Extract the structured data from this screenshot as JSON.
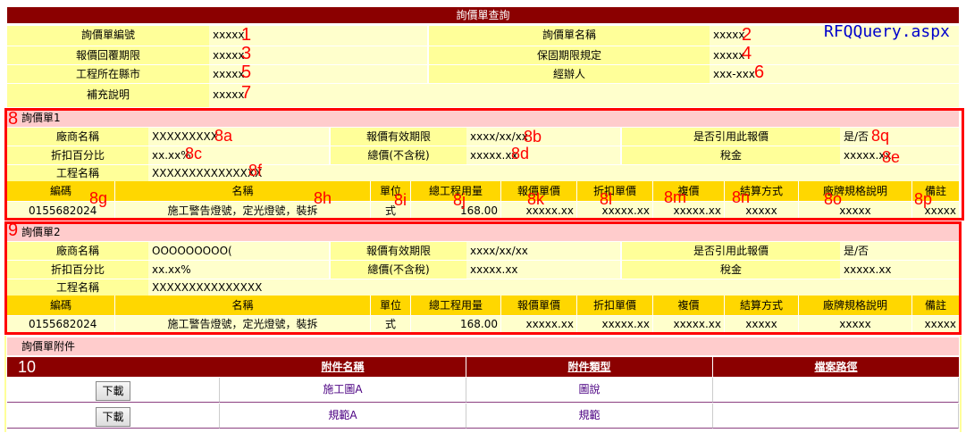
{
  "page_title": "詢價單查詢",
  "aspx": "RFQQuery.aspx",
  "header": {
    "rfq_no_label": "詢價單編號",
    "rfq_no_value": "xxxxx",
    "rfq_name_label": "詢價單名稱",
    "rfq_name_value": "xxxxx",
    "reply_deadline_label": "報價回覆期限",
    "reply_deadline_value": "xxxxx",
    "warranty_label": "保固期限規定",
    "warranty_value": "xxxxx",
    "location_label": "工程所在縣市",
    "location_value": "xxxxx",
    "handler_label": "經辦人",
    "handler_value": "xxx-xxx",
    "note_label": "補充說明",
    "note_value": "xxxxx"
  },
  "quotes": [
    {
      "title": "詢價單1",
      "vendor_label": "廠商名稱",
      "vendor_value": "XXXXXXXXX",
      "valid_label": "報價有效期限",
      "valid_value": "xxxx/xx/xx",
      "cite_label": "是否引用此報價",
      "cite_value": "是/否",
      "discount_label": "折扣百分比",
      "discount_value": "xx.xx%",
      "total_label": "總價(不含稅)",
      "total_value": "xxxxx.xx",
      "tax_label": "稅金",
      "tax_value": "xxxxx.xx",
      "project_label": "工程名稱",
      "project_value": "XXXXXXXXXXXXXXX",
      "row": {
        "code": "0155682024",
        "name": "施工警告燈號，定光燈號，裝拆",
        "unit": "式",
        "qty": "168.00",
        "unit_price": "xxxxx.xx",
        "disc_price": "xxxxx.xx",
        "re_price": "xxxxx.xx",
        "settle": "xxxxx",
        "spec": "xxxxx",
        "remark": "xxxxx"
      }
    },
    {
      "title": "詢價單2",
      "vendor_label": "廠商名稱",
      "vendor_value": "OOOOOOOOO(",
      "valid_label": "報價有效期限",
      "valid_value": "xxxx/xx/xx",
      "cite_label": "是否引用此報價",
      "cite_value": "是/否",
      "discount_label": "折扣百分比",
      "discount_value": "xx.xx%",
      "total_label": "總價(不含稅)",
      "total_value": "xxxxx.xx",
      "tax_label": "稅金",
      "tax_value": "xxxxx.xx",
      "project_label": "工程名稱",
      "project_value": "XXXXXXXXXXXXXXX",
      "row": {
        "code": "0155682024",
        "name": "施工警告燈號，定光燈號，裝拆",
        "unit": "式",
        "qty": "168.00",
        "unit_price": "xxxxx.xx",
        "disc_price": "xxxxx.xx",
        "re_price": "xxxxx.xx",
        "settle": "xxxxx",
        "spec": "xxxxx",
        "remark": "xxxxx"
      }
    }
  ],
  "columns": [
    "編碼",
    "名稱",
    "單位",
    "總工程用量",
    "報價單價",
    "折扣單價",
    "複價",
    "結算方式",
    "廠牌規格說明",
    "備註"
  ],
  "attachments": {
    "title": "詢價單附件",
    "col_name": "附件名稱",
    "col_type": "附件類型",
    "col_path": "檔案路徑",
    "download_label": "下載",
    "rows": [
      {
        "name": "施工圖A",
        "type": "圖說",
        "path": ""
      },
      {
        "name": "規範A",
        "type": "規範",
        "path": ""
      }
    ]
  },
  "annotations": {
    "n1": "1",
    "n2": "2",
    "n3": "3",
    "n4": "4",
    "n5": "5",
    "n6": "6",
    "n7": "7",
    "n8": "8",
    "n8a": "8a",
    "n8b": "8b",
    "n8c": "8c",
    "n8d": "8d",
    "n8e": "8e",
    "n8f": "8f",
    "n8g": "8g",
    "n8h": "8h",
    "n8i": "8i",
    "n8j": "8j",
    "n8k": "8k",
    "n8l": "8l",
    "n8m": "8m",
    "n8n": "8n",
    "n8o": "8o",
    "n8p": "8p",
    "n8q": "8q",
    "n9": "9",
    "n10": "10"
  },
  "colors": {
    "title_bg": "#8b0000",
    "highlight": "#ff0000",
    "label_bg": "#ffff99",
    "header_bg": "#ffd700"
  }
}
